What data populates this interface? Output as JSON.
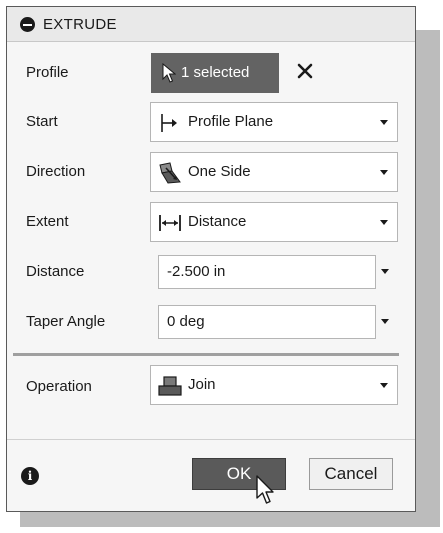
{
  "header": {
    "title": "EXTRUDE"
  },
  "fields": {
    "profile": {
      "label": "Profile",
      "button": "1 selected"
    },
    "start": {
      "label": "Start",
      "value": "Profile Plane"
    },
    "direction": {
      "label": "Direction",
      "value": "One Side"
    },
    "extent": {
      "label": "Extent",
      "value": "Distance"
    },
    "distance": {
      "label": "Distance",
      "value": "-2.500 in"
    },
    "taper": {
      "label": "Taper Angle",
      "value": "0 deg"
    },
    "operation": {
      "label": "Operation",
      "value": "Join"
    }
  },
  "footer": {
    "ok": "OK",
    "cancel": "Cancel"
  },
  "icons": {
    "collapse": "collapse-icon",
    "select": "select-arrow-icon",
    "clear": "close-icon",
    "start": "profile-plane-icon",
    "direction": "one-side-icon",
    "extent": "distance-icon",
    "operation": "join-icon",
    "info": "info-icon",
    "cursor": "mouse-pointer-icon"
  }
}
